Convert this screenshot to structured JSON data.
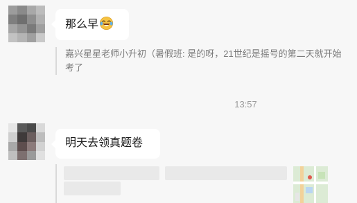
{
  "messages": [
    {
      "text": "那么早",
      "emoji": "laughing-tears-emoji",
      "quote": "嘉兴星星老师小升初（暑假班: 是的呀，21世纪是摇号的第二天就开始考了"
    },
    {
      "text": "明天去领真题卷",
      "quote_blurred": true
    }
  ],
  "timestamp": "13:57",
  "colors": {
    "background": "#f7f7f7",
    "bubble": "#ffffff",
    "quote_bar": "#d9d9d9",
    "muted_text": "#7a7a7a",
    "emoji_face": "#f5c242"
  }
}
